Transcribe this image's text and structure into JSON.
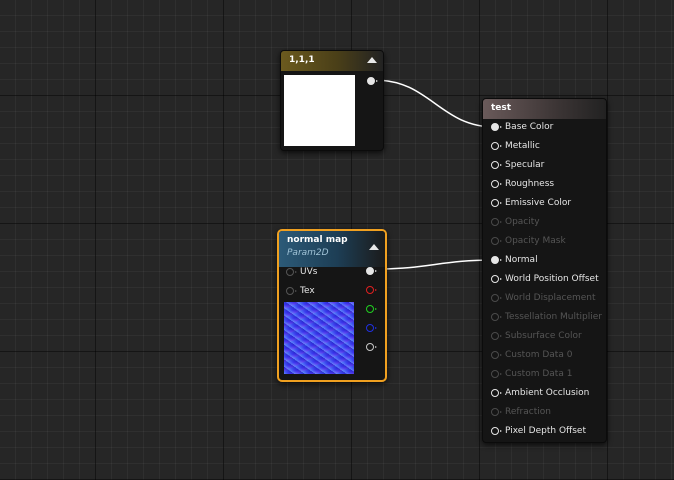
{
  "const_node": {
    "title": "1,1,1",
    "swatch_color": "#ffffff"
  },
  "texture_node": {
    "title": "normal map",
    "subtitle": "Param2D",
    "inputs": [
      "UVs",
      "Tex"
    ],
    "output_colors": [
      "#ffffff",
      "#e02020",
      "#20d020",
      "#2030e0",
      "#c8c8c8"
    ]
  },
  "material_node": {
    "title": "test",
    "inputs": [
      {
        "label": "Base Color",
        "enabled": true,
        "connected": true
      },
      {
        "label": "Metallic",
        "enabled": true,
        "connected": false
      },
      {
        "label": "Specular",
        "enabled": true,
        "connected": false
      },
      {
        "label": "Roughness",
        "enabled": true,
        "connected": false
      },
      {
        "label": "Emissive Color",
        "enabled": true,
        "connected": false
      },
      {
        "label": "Opacity",
        "enabled": false,
        "connected": false
      },
      {
        "label": "Opacity Mask",
        "enabled": false,
        "connected": false
      },
      {
        "label": "Normal",
        "enabled": true,
        "connected": true
      },
      {
        "label": "World Position Offset",
        "enabled": true,
        "connected": false
      },
      {
        "label": "World Displacement",
        "enabled": false,
        "connected": false
      },
      {
        "label": "Tessellation Multiplier",
        "enabled": false,
        "connected": false
      },
      {
        "label": "Subsurface Color",
        "enabled": false,
        "connected": false
      },
      {
        "label": "Custom Data 0",
        "enabled": false,
        "connected": false
      },
      {
        "label": "Custom Data 1",
        "enabled": false,
        "connected": false
      },
      {
        "label": "Ambient Occlusion",
        "enabled": true,
        "connected": false
      },
      {
        "label": "Refraction",
        "enabled": false,
        "connected": false
      },
      {
        "label": "Pixel Depth Offset",
        "enabled": true,
        "connected": false
      }
    ]
  },
  "colors": {
    "canvas_bg": "#262626",
    "selection_outline": "#f0a020",
    "wire": "#ffffff"
  }
}
